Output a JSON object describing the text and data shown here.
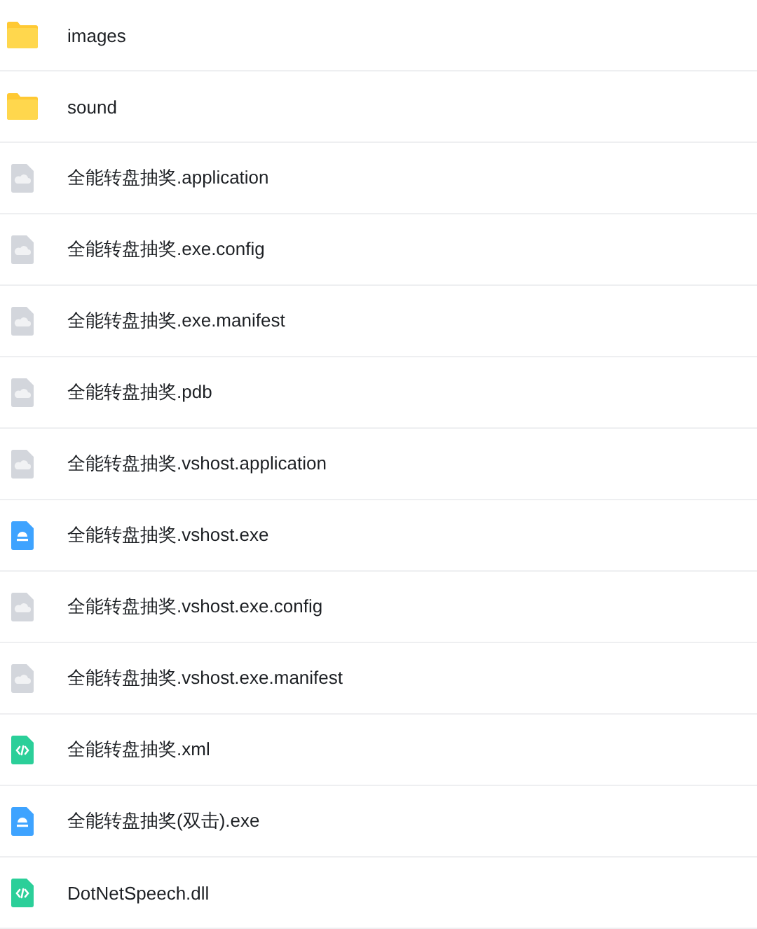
{
  "files": [
    {
      "name": "images",
      "kind": "folder"
    },
    {
      "name": "sound",
      "kind": "folder"
    },
    {
      "name": "全能转盘抽奖.application",
      "kind": "file"
    },
    {
      "name": "全能转盘抽奖.exe.config",
      "kind": "file"
    },
    {
      "name": "全能转盘抽奖.exe.manifest",
      "kind": "file"
    },
    {
      "name": "全能转盘抽奖.pdb",
      "kind": "file"
    },
    {
      "name": "全能转盘抽奖.vshost.application",
      "kind": "file"
    },
    {
      "name": "全能转盘抽奖.vshost.exe",
      "kind": "exe"
    },
    {
      "name": "全能转盘抽奖.vshost.exe.config",
      "kind": "file"
    },
    {
      "name": "全能转盘抽奖.vshost.exe.manifest",
      "kind": "file"
    },
    {
      "name": "全能转盘抽奖.xml",
      "kind": "code"
    },
    {
      "name": "全能转盘抽奖(双击).exe",
      "kind": "exe"
    },
    {
      "name": "DotNetSpeech.dll",
      "kind": "code"
    }
  ]
}
